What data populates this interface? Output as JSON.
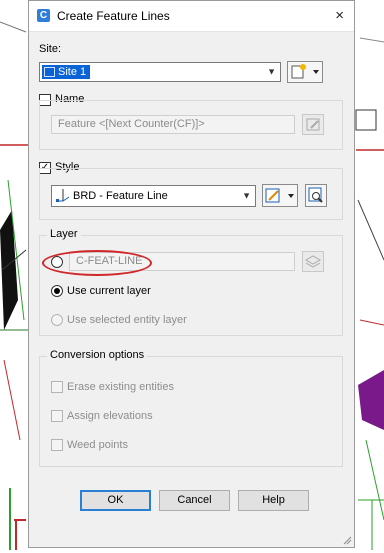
{
  "dialog": {
    "title": "Create Feature Lines",
    "app_icon_letter": "C",
    "close_symbol": "×"
  },
  "site": {
    "label": "Site:",
    "value": "Site 1"
  },
  "name": {
    "label": "Name",
    "checked": false,
    "value": "Feature <[Next Counter(CF)]>"
  },
  "style": {
    "label": "Style",
    "checked": true,
    "value": "BRD - Feature Line"
  },
  "layer": {
    "group_label": "Layer",
    "value": "C-FEAT-LINE",
    "use_current": "Use current layer",
    "use_selected": "Use selected entity layer"
  },
  "conversion": {
    "group_label": "Conversion options",
    "erase": "Erase existing entities",
    "assign": "Assign elevations",
    "weed": "Weed points"
  },
  "buttons": {
    "ok": "OK",
    "cancel": "Cancel",
    "help": "Help"
  },
  "colors": {
    "annotation_circle": "#d0282a",
    "selection_blue": "#0a64d8"
  }
}
